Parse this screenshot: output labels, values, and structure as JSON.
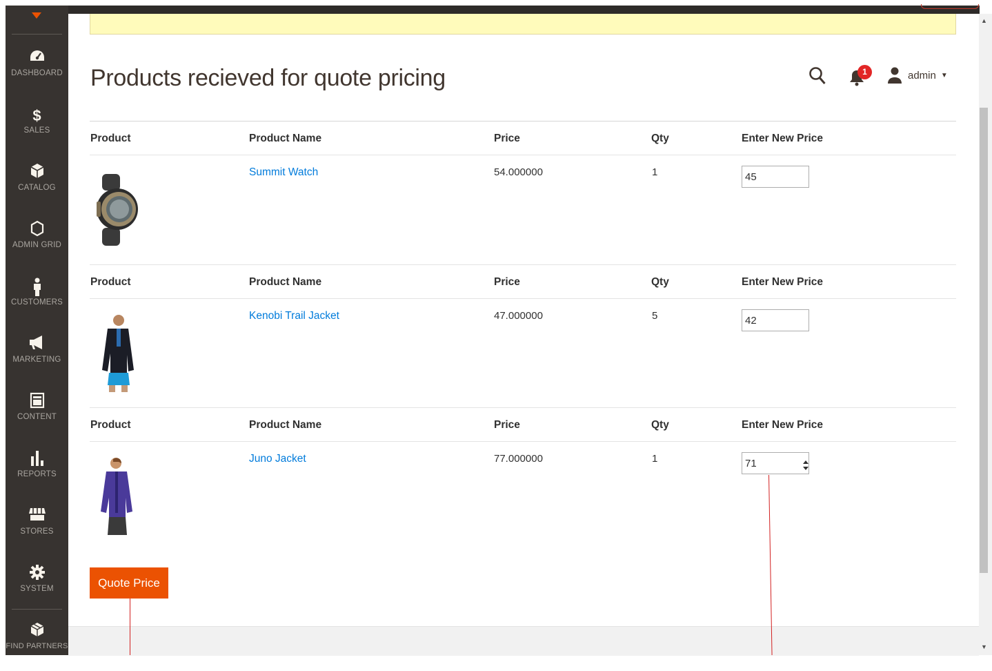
{
  "sidebar": {
    "items": [
      {
        "label": "DASHBOARD",
        "icon": "dashboard-icon"
      },
      {
        "label": "SALES",
        "icon": "dollar-icon"
      },
      {
        "label": "CATALOG",
        "icon": "cube-icon"
      },
      {
        "label": "ADMIN GRID",
        "icon": "hexagon-icon"
      },
      {
        "label": "CUSTOMERS",
        "icon": "person-icon"
      },
      {
        "label": "MARKETING",
        "icon": "megaphone-icon"
      },
      {
        "label": "CONTENT",
        "icon": "layout-icon"
      },
      {
        "label": "REPORTS",
        "icon": "bar-chart-icon"
      },
      {
        "label": "STORES",
        "icon": "storefront-icon"
      },
      {
        "label": "SYSTEM",
        "icon": "gear-icon"
      },
      {
        "label": "FIND PARTNERS",
        "icon": "blocks-icon"
      }
    ]
  },
  "header": {
    "title": "Products recieved for quote pricing",
    "notifications_count": "1",
    "user": "admin"
  },
  "table": {
    "headers": {
      "product": "Product",
      "name": "Product Name",
      "price": "Price",
      "qty": "Qty",
      "new_price": "Enter New Price"
    },
    "rows": [
      {
        "name": "Summit Watch",
        "price": "54.000000",
        "qty": "1",
        "new_price": "45",
        "image": "watch-image"
      },
      {
        "name": "Kenobi Trail Jacket",
        "price": "47.000000",
        "qty": "5",
        "new_price": "42",
        "image": "jacket-man-image"
      },
      {
        "name": "Juno Jacket",
        "price": "77.000000",
        "qty": "1",
        "new_price": "71",
        "image": "jacket-woman-image"
      }
    ]
  },
  "actions": {
    "quote_button": "Quote Price"
  },
  "colors": {
    "accent": "#eb5202",
    "link": "#007bdb",
    "sidebar": "#373330",
    "badge": "#e22626",
    "annotation": "#d21f1f"
  }
}
